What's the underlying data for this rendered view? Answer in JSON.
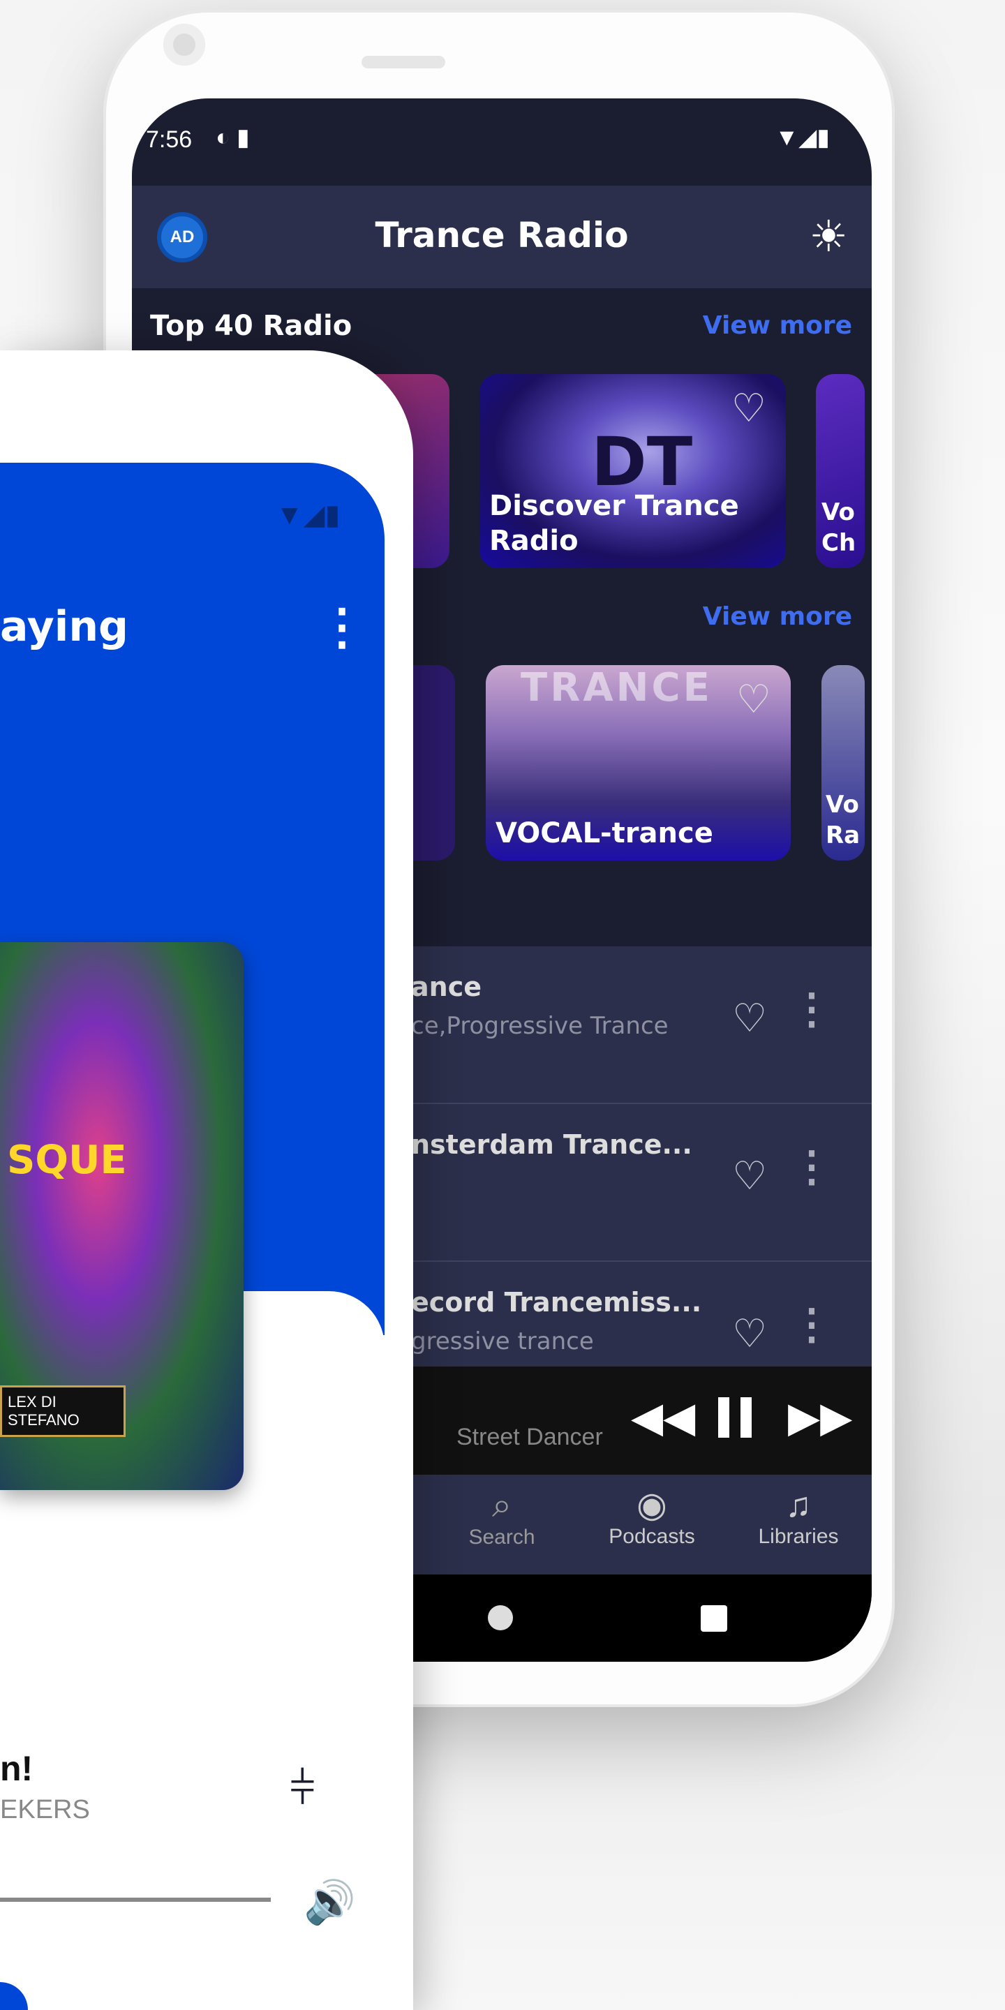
{
  "back_phone": {
    "status": {
      "time": "7:56"
    },
    "app_bar": {
      "title": "Trance Radio",
      "ad_icon": "ad-block-icon",
      "theme_icon": "sun-icon"
    },
    "sections": [
      {
        "title": "Top 40 Radio",
        "view_more": "View more",
        "cards": [
          {
            "label": ""
          },
          {
            "label": "Discover Trance Radio",
            "logo": "DT"
          },
          {
            "label": "Vo Ch"
          }
        ]
      },
      {
        "title": "",
        "view_more": "View more",
        "cards": [
          {
            "label": ""
          },
          {
            "label": "VOCAL-trance",
            "logo": "TRANCE"
          },
          {
            "label": "Vo Ra"
          }
        ]
      }
    ],
    "list": [
      {
        "title": "ance",
        "subtitle": "ce,Progressive Trance"
      },
      {
        "title": "nsterdam Trance...",
        "subtitle": ""
      },
      {
        "title": "ecord Trancemiss...",
        "subtitle": "gressive trance"
      }
    ],
    "mini_player": {
      "track": "Street Dancer"
    },
    "bottom_nav": [
      {
        "label": "Search",
        "icon": "search-icon"
      },
      {
        "label": "Podcasts",
        "icon": "podcast-icon"
      },
      {
        "label": "Libraries",
        "icon": "library-icon"
      }
    ],
    "colors": {
      "background": "#1b1d30",
      "bar": "#2c2f4b",
      "accent": "#3f6df0"
    }
  },
  "front_phone": {
    "header": "aying",
    "album_art_text": "LEX DI STEFANO",
    "album_title": "SQUE",
    "track_title": "n!",
    "artist": "EKERS",
    "colors": {
      "primary": "#0047d8"
    }
  }
}
